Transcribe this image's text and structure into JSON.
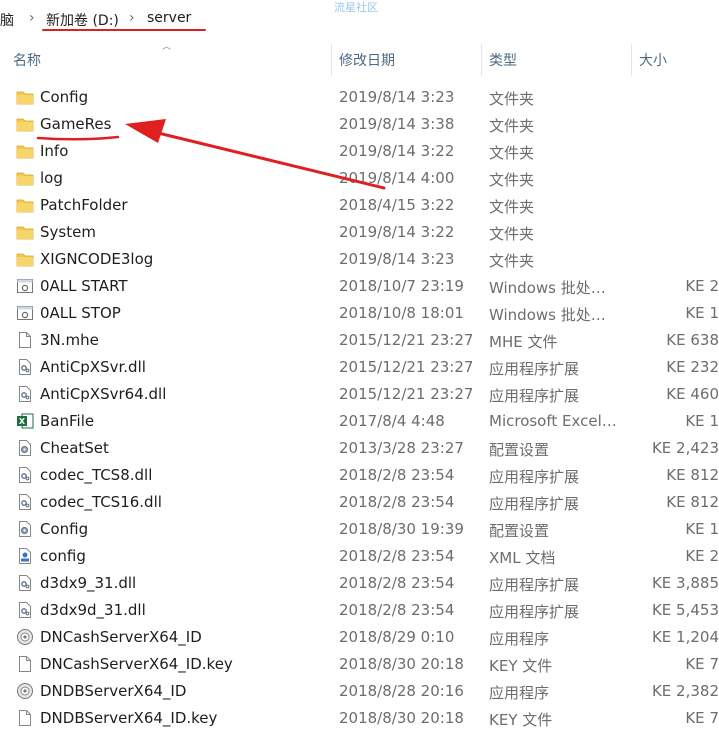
{
  "breadcrumb": {
    "items": [
      "脑",
      "新加卷 (D:)",
      "server"
    ],
    "separator": "›"
  },
  "watermark": "流星社区",
  "columns": {
    "name": "名称",
    "date": "修改日期",
    "type": "类型",
    "size": "大小"
  },
  "files": [
    {
      "name": "Config",
      "date": "2019/8/14 3:23",
      "type": "文件夹",
      "size": "",
      "icon": "folder-icon"
    },
    {
      "name": "GameRes",
      "date": "2019/8/14 3:38",
      "type": "文件夹",
      "size": "",
      "icon": "folder-icon"
    },
    {
      "name": "Info",
      "date": "2019/8/14 3:22",
      "type": "文件夹",
      "size": "",
      "icon": "folder-icon"
    },
    {
      "name": "log",
      "date": "2019/8/14 4:00",
      "type": "文件夹",
      "size": "",
      "icon": "folder-icon"
    },
    {
      "name": "PatchFolder",
      "date": "2018/4/15 3:22",
      "type": "文件夹",
      "size": "",
      "icon": "folder-icon"
    },
    {
      "name": "System",
      "date": "2019/8/14 3:22",
      "type": "文件夹",
      "size": "",
      "icon": "folder-icon"
    },
    {
      "name": "XIGNCODE3log",
      "date": "2019/8/14 3:23",
      "type": "文件夹",
      "size": "",
      "icon": "folder-icon"
    },
    {
      "name": "0ALL START",
      "date": "2018/10/7 23:19",
      "type": "Windows 批处理...",
      "size": "2 KE",
      "icon": "batch-file-icon"
    },
    {
      "name": "0ALL STOP",
      "date": "2018/10/8 18:01",
      "type": "Windows 批处理...",
      "size": "1 KE",
      "icon": "batch-file-icon"
    },
    {
      "name": "3N.mhe",
      "date": "2015/12/21 23:27",
      "type": "MHE 文件",
      "size": "638 KE",
      "icon": "generic-file-icon"
    },
    {
      "name": "AntiCpXSvr.dll",
      "date": "2015/12/21 23:27",
      "type": "应用程序扩展",
      "size": "232 KE",
      "icon": "dll-file-icon"
    },
    {
      "name": "AntiCpXSvr64.dll",
      "date": "2015/12/21 23:27",
      "type": "应用程序扩展",
      "size": "460 KE",
      "icon": "dll-file-icon"
    },
    {
      "name": "BanFile",
      "date": "2017/8/4 4:48",
      "type": "Microsoft Excel ...",
      "size": "1 KE",
      "icon": "excel-file-icon"
    },
    {
      "name": "CheatSet",
      "date": "2013/3/28 23:27",
      "type": "配置设置",
      "size": "2,423 KE",
      "icon": "config-file-icon"
    },
    {
      "name": "codec_TCS8.dll",
      "date": "2018/2/8 23:54",
      "type": "应用程序扩展",
      "size": "812 KE",
      "icon": "dll-file-icon"
    },
    {
      "name": "codec_TCS16.dll",
      "date": "2018/2/8 23:54",
      "type": "应用程序扩展",
      "size": "812 KE",
      "icon": "dll-file-icon"
    },
    {
      "name": "Config",
      "date": "2018/8/30 19:39",
      "type": "配置设置",
      "size": "1 KE",
      "icon": "config-file-icon"
    },
    {
      "name": "config",
      "date": "2018/2/8 23:54",
      "type": "XML 文档",
      "size": "2 KE",
      "icon": "xml-file-icon"
    },
    {
      "name": "d3dx9_31.dll",
      "date": "2018/2/8 23:54",
      "type": "应用程序扩展",
      "size": "3,885 KE",
      "icon": "dll-file-icon"
    },
    {
      "name": "d3dx9d_31.dll",
      "date": "2018/2/8 23:54",
      "type": "应用程序扩展",
      "size": "5,453 KE",
      "icon": "dll-file-icon"
    },
    {
      "name": "DNCashServerX64_ID",
      "date": "2018/8/29 0:10",
      "type": "应用程序",
      "size": "1,204 KE",
      "icon": "exe-file-icon"
    },
    {
      "name": "DNCashServerX64_ID.key",
      "date": "2018/8/30 20:18",
      "type": "KEY 文件",
      "size": "7 KE",
      "icon": "generic-file-icon"
    },
    {
      "name": "DNDBServerX64_ID",
      "date": "2018/8/28 20:16",
      "type": "应用程序",
      "size": "2,382 KE",
      "icon": "exe-file-icon"
    },
    {
      "name": "DNDBServerX64_ID.key",
      "date": "2018/8/30 20:18",
      "type": "KEY 文件",
      "size": "7 KE",
      "icon": "generic-file-icon"
    }
  ],
  "colors": {
    "annotation": "#e02020",
    "folder": "#f2c94c",
    "header_text": "#4d6a85"
  }
}
